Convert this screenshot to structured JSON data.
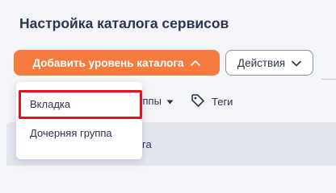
{
  "header": {
    "title": "Настройка каталога сервисов"
  },
  "toolbar": {
    "add_level_label": "Добавить уровень каталога",
    "actions_label": "Действия"
  },
  "filters": {
    "groups_label": "уппы",
    "tags_label": "Теги"
  },
  "dropdown": {
    "items": [
      {
        "label": "Вкладка",
        "highlighted": true
      },
      {
        "label": "Дочерняя группа"
      }
    ]
  },
  "table": {
    "row_text": "га"
  },
  "colors": {
    "primary": "#f57a3d",
    "highlight_border": "#e0141f",
    "text": "#2b3551",
    "background": "#f4f5f9"
  },
  "icons": {
    "add_chevron": "chevron-up-icon",
    "actions_chevron": "chevron-down-icon",
    "groups_caret": "caret-down-icon",
    "tags": "tag-icon"
  }
}
